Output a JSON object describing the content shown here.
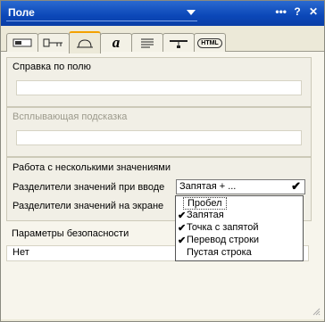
{
  "window": {
    "title": "Поле"
  },
  "title_icons": {
    "menu": "•••",
    "help": "?",
    "close": "✕"
  },
  "tabs": [
    {
      "name": "basics-tab",
      "icon": "field-shape-icon"
    },
    {
      "name": "control-tab",
      "icon": "key-icon"
    },
    {
      "name": "advanced-tab",
      "icon": "helmet-icon"
    },
    {
      "name": "font-tab",
      "icon": "italic-a-icon",
      "glyph": "a"
    },
    {
      "name": "paragraph-tab",
      "icon": "paragraph-icon"
    },
    {
      "name": "hide-tab",
      "icon": "hide-when-icon"
    },
    {
      "name": "html-tab",
      "icon": "html-icon",
      "glyph": "HTML"
    }
  ],
  "sections": {
    "help": {
      "label": "Справка по полю",
      "value": ""
    },
    "tooltip": {
      "label": "Всплывающая подсказка",
      "value": ""
    },
    "multi": {
      "label": "Работа с несколькими значениями",
      "input_sep_label": "Разделители значений при вводе",
      "input_sep_value": "Запятая + ...",
      "display_sep_label": "Разделители значений на экране"
    },
    "security": {
      "label": "Параметры безопасности",
      "value": "Нет"
    }
  },
  "dropdown_options": [
    {
      "label": "Пробел",
      "checked": false
    },
    {
      "label": "Запятая",
      "checked": true
    },
    {
      "label": "Точка с запятой",
      "checked": true
    },
    {
      "label": "Перевод строки",
      "checked": true
    },
    {
      "label": "Пустая строка",
      "checked": false
    }
  ],
  "check_glyph": "✔",
  "colors": {
    "title_bar": "#0b47b8",
    "active_tab_accent": "#f3a100",
    "panel_bg": "#f7f5ec"
  }
}
